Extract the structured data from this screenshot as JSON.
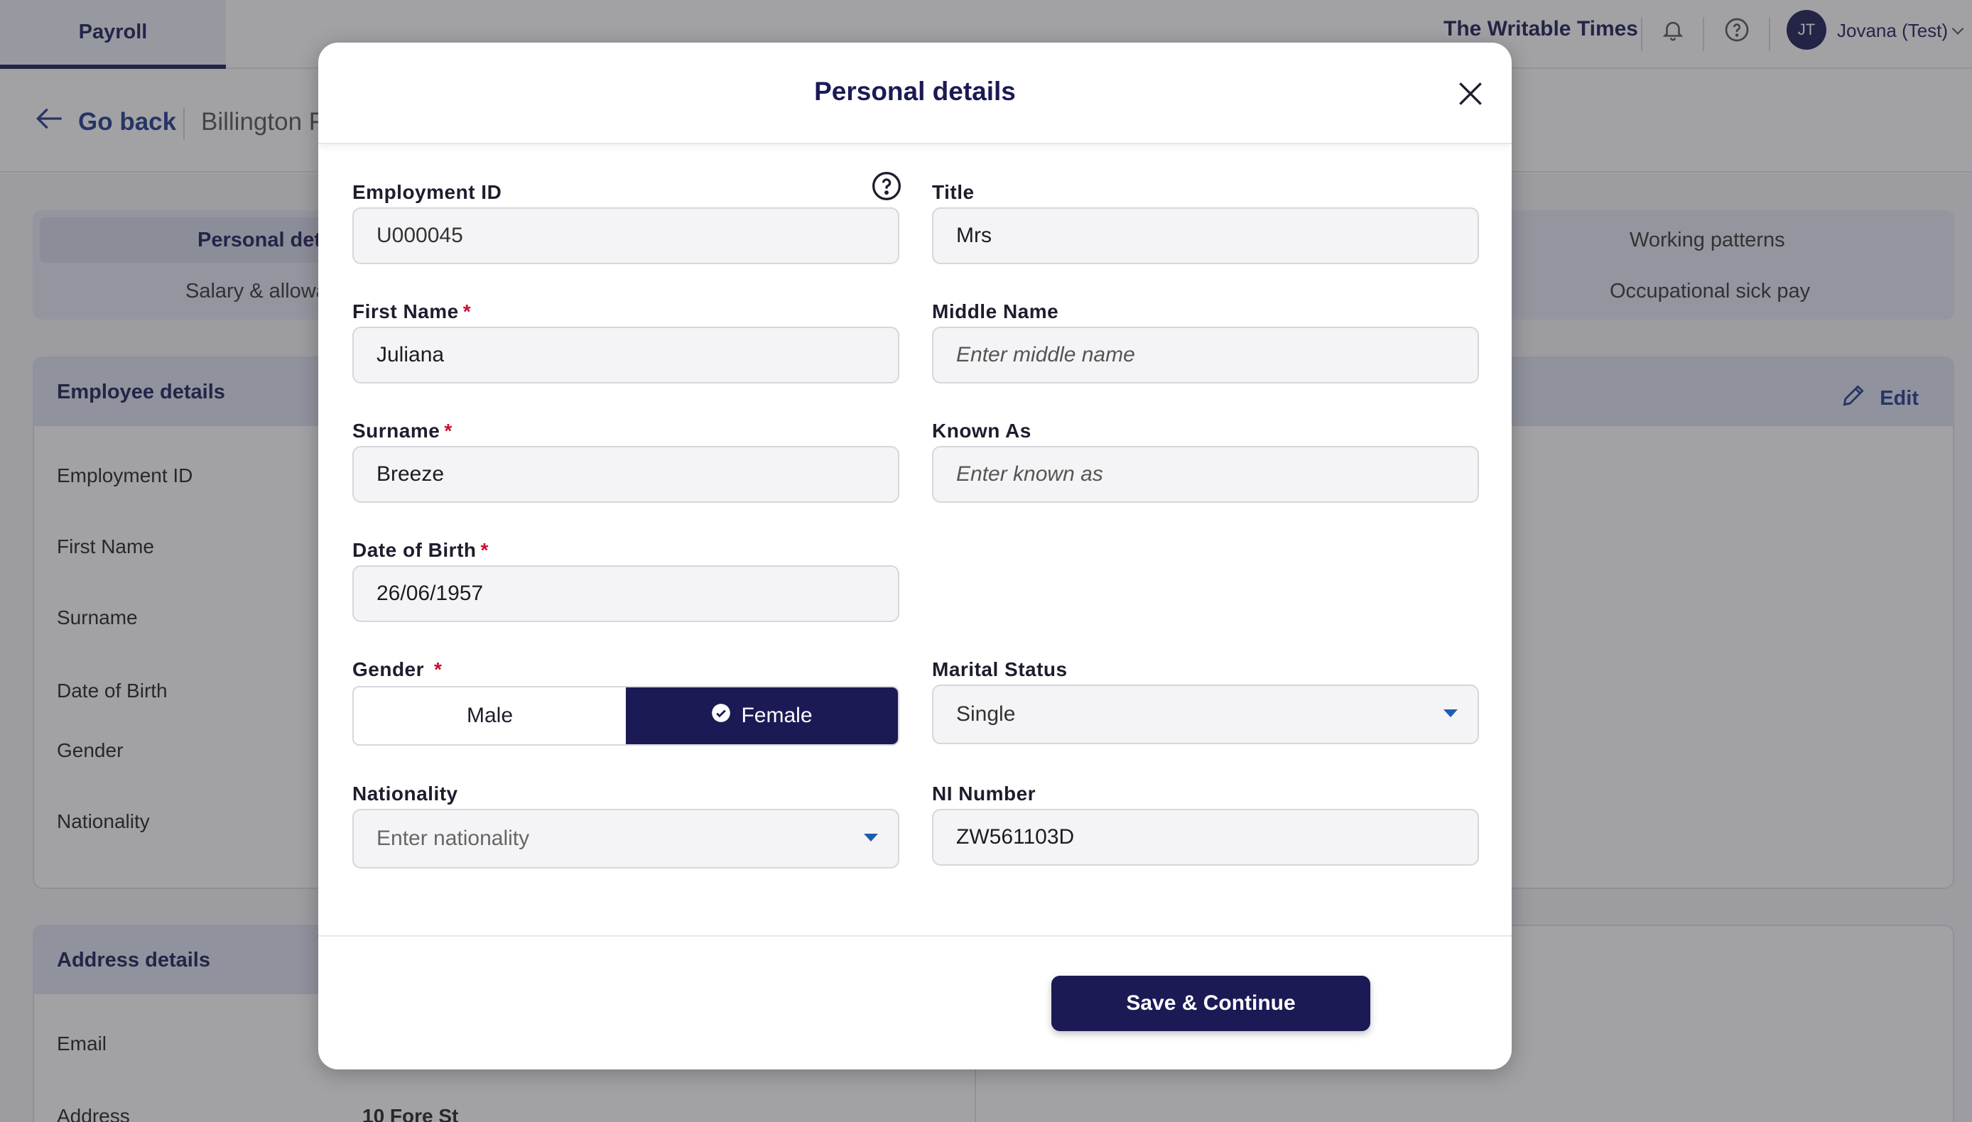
{
  "app": {
    "tab_payroll": "Payroll",
    "company": "The Writable Times",
    "user_initials": "JT",
    "user_name": "Jovana (Test)",
    "go_back": "Go back",
    "employee_name_partial": "Billington F"
  },
  "background_tabs": {
    "personal": "Personal det",
    "salary": "Salary & allowa",
    "working_patterns": "Working patterns",
    "sick_pay": "Occupational sick pay"
  },
  "employee_card": {
    "title": "Employee details",
    "edit_label": "Edit",
    "rows": [
      "Employment ID",
      "First Name",
      "Surname",
      "Date of Birth",
      "Gender",
      "Nationality"
    ]
  },
  "address_card": {
    "title": "Address details",
    "rows": [
      "Email",
      "Address"
    ],
    "address_value": "10 Fore St"
  },
  "modal": {
    "title": "Personal details",
    "employment_id": {
      "label": "Employment ID",
      "value": "U000045"
    },
    "title_field": {
      "label": "Title",
      "value": "Mrs"
    },
    "first_name": {
      "label": "First Name",
      "value": "Juliana",
      "required": "*"
    },
    "middle_name": {
      "label": "Middle Name",
      "placeholder": "Enter middle name"
    },
    "surname": {
      "label": "Surname",
      "value": "Breeze",
      "required": "*"
    },
    "known_as": {
      "label": "Known As",
      "placeholder": "Enter known as"
    },
    "dob": {
      "label": "Date of Birth",
      "value": "26/06/1957",
      "required": "*"
    },
    "gender": {
      "label": "Gender",
      "required": "*",
      "options": [
        "Male",
        "Female"
      ],
      "selected": "Female"
    },
    "marital_status": {
      "label": "Marital Status",
      "value": "Single"
    },
    "nationality": {
      "label": "Nationality",
      "placeholder": "Enter nationality"
    },
    "ni_number": {
      "label": "NI Number",
      "value": "ZW561103D"
    },
    "save_label": "Save & Continue"
  }
}
